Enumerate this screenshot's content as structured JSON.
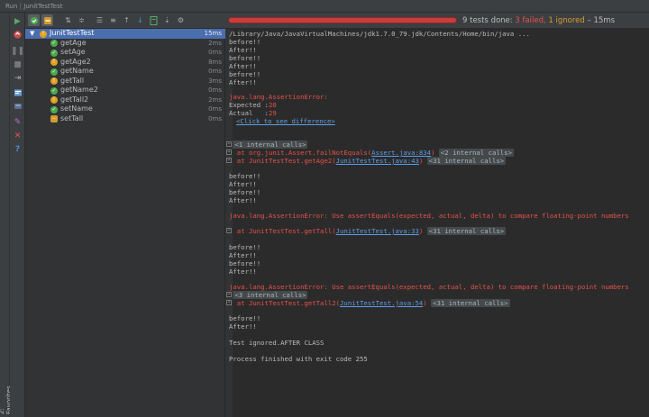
{
  "window": {
    "run_label": "Run",
    "config_name": "JunitTestTest"
  },
  "favorites_label": "2: Favorites",
  "status": {
    "done": "9 tests done:",
    "failed": "3 failed,",
    "ignored": "1 ignored",
    "time": "– 15ms",
    "progress_state": "failed"
  },
  "tree": {
    "root": {
      "name": "JunitTestTest",
      "duration": "15ms",
      "state": "warning"
    },
    "items": [
      {
        "name": "getAge",
        "duration": "2ms",
        "state": "passed"
      },
      {
        "name": "setAge",
        "duration": "0ms",
        "state": "passed"
      },
      {
        "name": "getAge2",
        "duration": "8ms",
        "state": "failed"
      },
      {
        "name": "getName",
        "duration": "0ms",
        "state": "passed"
      },
      {
        "name": "getTall",
        "duration": "3ms",
        "state": "failed"
      },
      {
        "name": "getName2",
        "duration": "0ms",
        "state": "passed"
      },
      {
        "name": "getTall2",
        "duration": "2ms",
        "state": "failed"
      },
      {
        "name": "setName",
        "duration": "0ms",
        "state": "passed"
      },
      {
        "name": "setTall",
        "duration": "0ms",
        "state": "ignored"
      }
    ]
  },
  "console": {
    "l1": "/Library/Java/JavaVirtualMachines/jdk1.7.0_79.jdk/Contents/Home/bin/java ...",
    "before": "before!!",
    "after": "After!!",
    "assertion_error": "java.lang.AssertionError:",
    "expected_label": "Expected :",
    "expected_value": "20",
    "actual_label": "Actual   :",
    "actual_value": "29",
    "click_diff": "<Click to see difference>",
    "internal1": "<1 internal calls>",
    "stack1_pre": "at org.junit.Assert.failNotEquals(",
    "stack1_link": "Assert.java:834",
    "stack1_post": ")",
    "internal2": "<2 internal calls>",
    "stack2_pre": "at JunitTestTest.getAge2(",
    "stack2_link": "JunitTestTest.java:43",
    "stack2_post": ")",
    "internal31": "<31 internal calls>",
    "floating_error": "java.lang.AssertionError: Use assertEquals(expected, actual, delta) to compare floating-point numbers",
    "stack3_pre": "at JunitTestTest.getTall(",
    "stack3_link": "JunitTestTest.java:33",
    "stack3_post": ")",
    "internal3": "<3 internal calls>",
    "stack4_pre": "at JunitTestTest.getTall2(",
    "stack4_link": "JunitTestTest.java:54",
    "stack4_post": ")",
    "ignored_line": "Test ignored.AFTER CLASS",
    "process_line": "Process finished with exit code 255"
  }
}
